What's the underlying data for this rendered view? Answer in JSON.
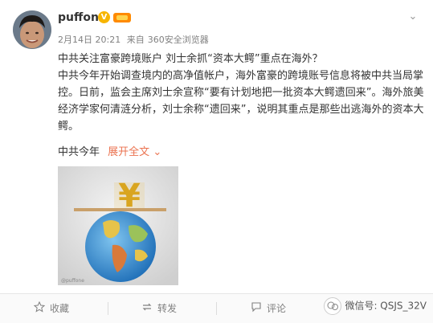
{
  "post": {
    "author": "puffone",
    "verified_badge": "V",
    "time": "2月14日 20:21",
    "source_prefix": "来自",
    "source": "360安全浏览器",
    "headline": "中共关注富豪跨境账户 刘士余抓“资本大鳄”重点在海外？",
    "body": "中共今年开始调查境内的高净值帐户，海外富豪的跨境账号信息将被中共当局掌控。日前，监会主席刘士余宣称“要有计划地把一批资本大鳄遗回来”。海外旅美经济学家何清涟分析，刘士余称“遗回来”，说明其重点是那些出逃海外的资本大鳄。",
    "excerpt": "中共今年",
    "expand_label": "展开全文",
    "expand_icon": "chevron-down-icon",
    "image_watermark": "@puffone",
    "image_symbol": "¥"
  },
  "toolbar": {
    "favorite_label": "收藏",
    "repost_label": "转发",
    "comment_label": "评论"
  },
  "watermark": {
    "text": "微信号: QSJS_32V"
  },
  "colors": {
    "link": "#eb7350",
    "verified": "#f7b500",
    "muted": "#808080"
  }
}
